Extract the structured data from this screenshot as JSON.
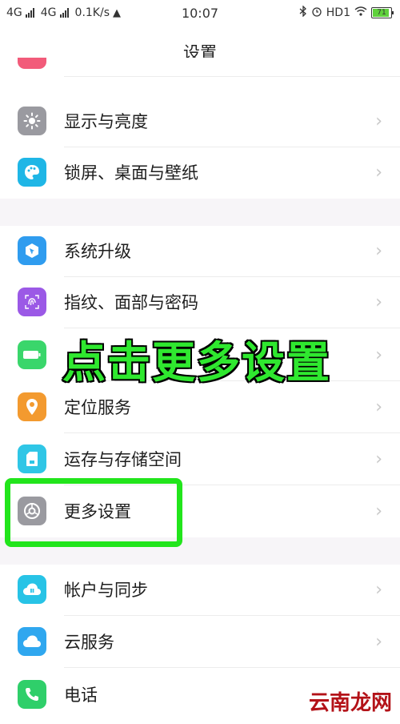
{
  "status_bar": {
    "net1": "4G",
    "net2": "4G",
    "speed": "0.1K/s",
    "time": "10:07",
    "hd": "HD1",
    "battery": "71"
  },
  "header": {
    "title": "设置"
  },
  "settings": {
    "items": [
      {
        "label": "显示与亮度",
        "icon": "sun-icon",
        "color": "#9a9aa0"
      },
      {
        "label": "锁屏、桌面与壁纸",
        "icon": "palette-icon",
        "color": "#1fb6e6"
      },
      {
        "label": "系统升级",
        "icon": "upgrade-icon",
        "color": "#2f9cef"
      },
      {
        "label": "指纹、面部与密码",
        "icon": "fingerprint-icon",
        "color": "#9b59e6"
      },
      {
        "label": "",
        "icon": "battery-icon",
        "color": "#3ad66b"
      },
      {
        "label": "定位服务",
        "icon": "location-icon",
        "color": "#f39a2f"
      },
      {
        "label": "运存与存储空间",
        "icon": "storage-icon",
        "color": "#2fc6e6"
      },
      {
        "label": "更多设置",
        "icon": "gear-icon",
        "color": "#9a9aa0"
      },
      {
        "label": "帐户与同步",
        "icon": "account-sync-icon",
        "color": "#27c3e6"
      },
      {
        "label": "云服务",
        "icon": "cloud-icon",
        "color": "#2fa7ef"
      },
      {
        "label": "电话",
        "icon": "phone-icon",
        "color": "#2fcf6a"
      }
    ]
  },
  "overlay": {
    "instruction": "点击更多设置",
    "highlight_color": "#22e51c"
  },
  "watermark": "云南龙网"
}
